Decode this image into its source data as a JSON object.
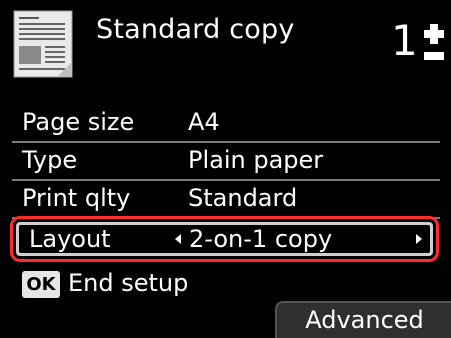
{
  "header": {
    "title": "Standard copy",
    "copies": "1",
    "icon": "document-icon"
  },
  "settings": [
    {
      "label": "Page size",
      "value": "A4"
    },
    {
      "label": "Type",
      "value": "Plain paper"
    },
    {
      "label": "Print qlty",
      "value": "Standard"
    }
  ],
  "selected_setting": {
    "label": "Layout",
    "value": "2-on-1 copy"
  },
  "footer": {
    "ok_label": "OK",
    "end_setup": "End setup",
    "advanced_label": "Advanced"
  },
  "colors": {
    "background": "#000000",
    "highlight_border": "#ff2a2a",
    "advanced_button": "#2f2f2f"
  }
}
